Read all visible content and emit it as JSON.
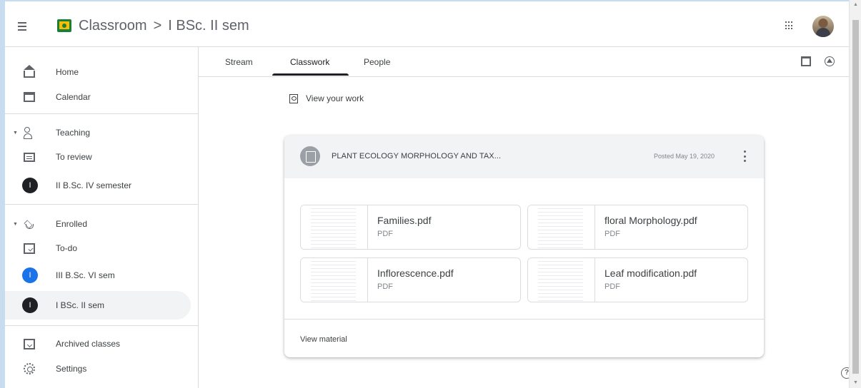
{
  "header": {
    "app_name": "Classroom",
    "separator": ">",
    "class_name": "I BSc. II sem",
    "icons": [
      "menu-icon",
      "google-apps-icon",
      "account-avatar"
    ]
  },
  "sidebar": {
    "home": "Home",
    "calendar": "Calendar",
    "teaching": "Teaching",
    "to_review": "To review",
    "teaching_classes": [
      {
        "initial": "I",
        "label": "II B.Sc. IV semester"
      }
    ],
    "enrolled": "Enrolled",
    "todo": "To-do",
    "enrolled_classes": [
      {
        "initial": "I",
        "label": "III B.Sc. VI sem",
        "color": "#1a73e8"
      },
      {
        "initial": "I",
        "label": "I BSc. II sem",
        "color": "#202124",
        "active": true
      }
    ],
    "archived": "Archived classes",
    "settings": "Settings"
  },
  "tabs": {
    "items": [
      "Stream",
      "Classwork",
      "People"
    ],
    "active": "Classwork"
  },
  "view_work": "View your work",
  "material": {
    "title": "PLANT ECOLOGY MORPHOLOGY AND TAX...",
    "posted": "Posted May 19, 2020",
    "attachments": [
      {
        "name": "Families.pdf",
        "type": "PDF"
      },
      {
        "name": "floral Morphology.pdf",
        "type": "PDF"
      },
      {
        "name": "Inflorescence.pdf",
        "type": "PDF"
      },
      {
        "name": "Leaf modification.pdf",
        "type": "PDF"
      }
    ],
    "footer": "View material"
  },
  "help": "?",
  "colors": {
    "active_tab_underline": "#202124",
    "active_nav_bg": "#f1f3f4",
    "logo_green": "#188038",
    "logo_yellow": "#fbbc04",
    "class_blue": "#1a73e8"
  }
}
